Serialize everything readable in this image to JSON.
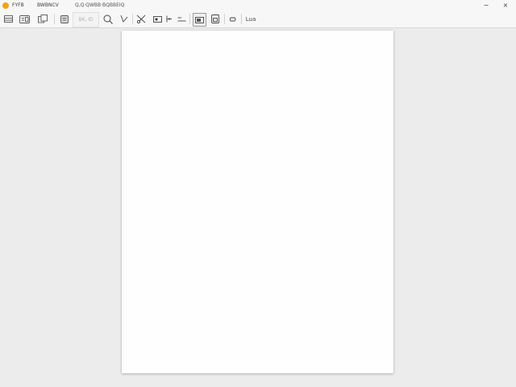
{
  "titlebar": {
    "app_name": "FYFB",
    "menu": "BWBNCV",
    "path": "Q,Q·QWBB·BQBBEIQ",
    "minimize_glyph": "−",
    "close_glyph": "×",
    "accent_color": "#f2a318"
  },
  "toolbar": {
    "disabled_label": "BK, ID",
    "text_label": "Lua",
    "items": [
      "menu-icon",
      "caption-icon",
      "copy-icon",
      "save-icon",
      "search-icon",
      "pen-icon",
      "scissors-icon",
      "frame-icon",
      "split-icon",
      "align-icon",
      "capture-icon",
      "page-icon",
      "link-icon",
      "text-tool"
    ]
  }
}
